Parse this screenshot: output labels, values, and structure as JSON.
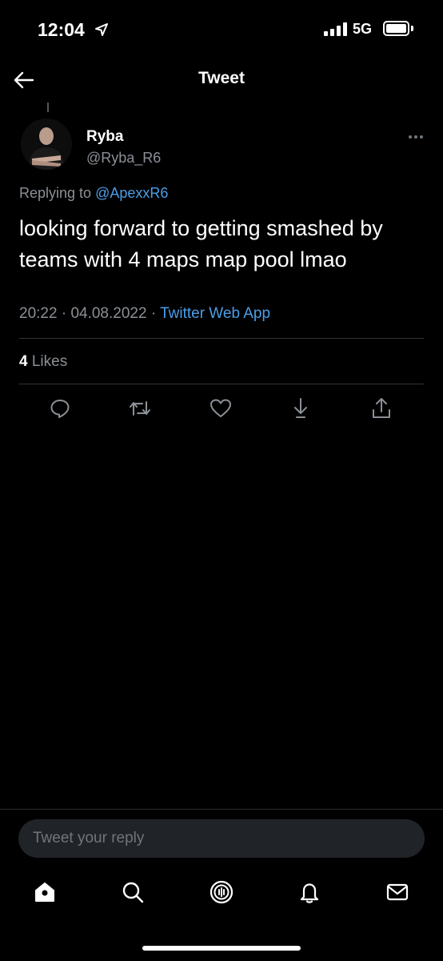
{
  "status_bar": {
    "time": "12:04",
    "network": "5G",
    "location_icon": "location-arrow-icon",
    "signal_icon": "signal-bars-icon",
    "battery_icon": "battery-full-icon"
  },
  "header": {
    "title": "Tweet",
    "back_icon": "back-arrow-icon"
  },
  "tweet": {
    "author_name": "Ryba",
    "author_handle": "@Ryba_R6",
    "replying_prefix": "Replying to",
    "replying_to": "@ApexxR6",
    "text": "looking forward to getting smashed by teams with 4 maps map pool lmao",
    "time": "20:22",
    "separator": "·",
    "date": "04.08.2022",
    "source": "Twitter Web App",
    "likes_count": "4",
    "likes_label": "Likes"
  },
  "actions": [
    {
      "icon": "reply-icon"
    },
    {
      "icon": "retweet-icon"
    },
    {
      "icon": "like-heart-icon"
    },
    {
      "icon": "bookmark-download-icon"
    },
    {
      "icon": "share-icon"
    }
  ],
  "composer": {
    "placeholder": "Tweet your reply"
  },
  "tab_bar": [
    {
      "icon": "home-icon"
    },
    {
      "icon": "search-icon"
    },
    {
      "icon": "spaces-icon"
    },
    {
      "icon": "notifications-bell-icon"
    },
    {
      "icon": "messages-envelope-icon"
    }
  ],
  "colors": {
    "background": "#000000",
    "link": "#4a9fe8",
    "muted": "#8b9096",
    "divider": "#2f3336"
  }
}
